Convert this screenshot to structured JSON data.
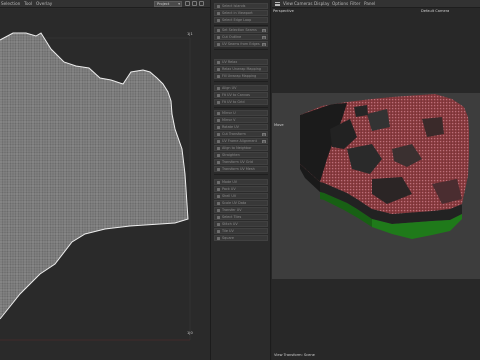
{
  "uv_editor": {
    "menu": [
      "Selection",
      "Tool",
      "Overlay"
    ],
    "projection_select": "Project",
    "corner_top_right": "1|1",
    "corner_bottom_right": "1|0"
  },
  "tools_panel": {
    "groups": [
      [
        "Select Islands",
        "Select in Viewport",
        "Select Edge Loop"
      ],
      [
        "Set Selection Seams",
        "Cut Outline",
        "UV Seams from Edges"
      ],
      [
        "UV Relax",
        "Relax Unwrap Mapping",
        "Fill Unwrap Mapping"
      ],
      [
        "Align UV",
        "Fit UV to Canvas",
        "Fit UV to Grid"
      ],
      [
        "Mirror U",
        "Mirror V",
        "Rotate UV",
        "Cut Transform",
        "UV Frame Alignment",
        "Align to Neighbor",
        "Straighten",
        "Transform UV Grid",
        "Transform UV Mesh"
      ],
      [
        "Mode UV",
        "Pack UV",
        "Shell UV",
        "Scale UV Data",
        "Transfer UV",
        "Select Tiles",
        "Stitch UV",
        "Tile UV",
        "Square"
      ]
    ]
  },
  "viewport": {
    "menu": [
      "View",
      "Cameras",
      "Display",
      "Options",
      "Filter",
      "Panel"
    ],
    "camera_mode": "Perspective",
    "active_camera": "Default Camera",
    "axis_label": "Move",
    "bottom_status": "View Transform: Scene"
  },
  "colors": {
    "city_red": "#8a3a3e",
    "city_dark": "#1b1b1b",
    "terrain_edge": "#1f7a1a",
    "uv_grid_line": "#cfcfcf",
    "uv_boundary": "#e8e8e8"
  }
}
